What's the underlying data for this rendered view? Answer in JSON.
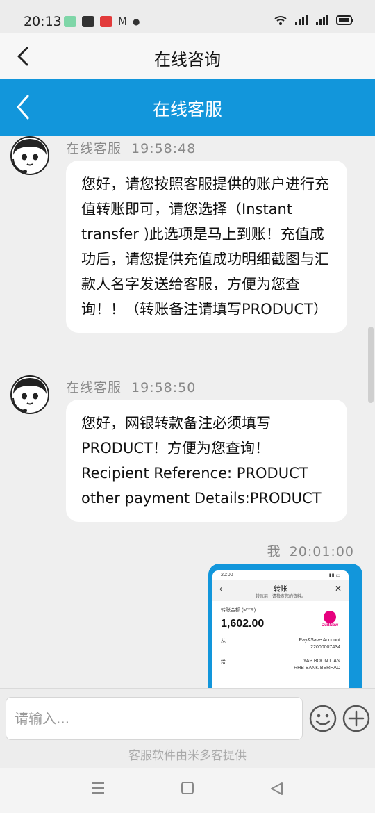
{
  "status_bar": {
    "time": "20:13"
  },
  "top_nav": {
    "title": "在线咨询"
  },
  "chat_header": {
    "title": "在线客服"
  },
  "messages": [
    {
      "sender": "在线客服",
      "time": "19:58:48",
      "text": "您好，请您按照客服提供的账户进行充值转账即可，请您选择（Instant transfer )此选项是马上到账！充值成功后，请您提供充值成功明细截图与汇款人名字发送给客服，方便为您查询！！（转账备注请填写PRODUCT）"
    },
    {
      "sender": "在线客服",
      "time": "19:58:50",
      "text": "您好，网银转款备注必须填写PRODUCT！方便为您查询！Recipient Reference: PRODUCT other payment Details:PRODUCT"
    }
  ],
  "my_message": {
    "sender": "我",
    "time": "20:01:00",
    "screenshot": {
      "status_time": "20:00",
      "title": "转账",
      "subtitle": "转账前，请检查您的资料。",
      "amount_label": "转账金额 (MYR)",
      "amount": "1,602.00",
      "brand": "DuitNow",
      "from_label": "从",
      "from_account_type": "Pay&Save Account",
      "from_account_no": "22000007434",
      "to_label": "给",
      "to_name": "YAP BOON LIAN",
      "to_bank": "RHB BANK BERHAD"
    }
  },
  "input": {
    "placeholder": "请输入..."
  },
  "footer": {
    "powered_by": "客服软件由米多客提供"
  },
  "colors": {
    "header_blue": "#1296db",
    "bubble_white": "#ffffff",
    "background": "#efefef"
  }
}
